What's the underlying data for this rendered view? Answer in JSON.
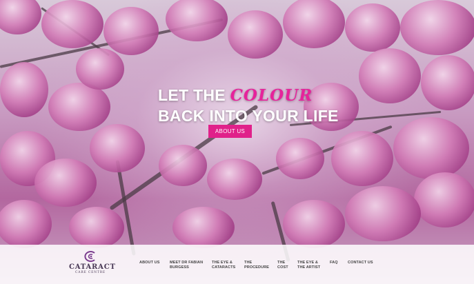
{
  "hero": {
    "title_part1": "LET THE ",
    "title_accent": "COLOUR",
    "title_line2": "BACK INTO YOUR LIFE",
    "cta_label": "ABOUT US"
  },
  "logo": {
    "name": "CATARACT",
    "tagline": "CARE CENTRE"
  },
  "nav": [
    "ABOUT US",
    "MEET DR FABIAN\nBURGESS",
    "THE EYE &\nCATARACTS",
    "THE\nPROCEDURE",
    "THE\nCOST",
    "THE EYE &\nTHE ARTIST",
    "FAQ",
    "CONTACT US"
  ],
  "colors": {
    "accent": "#e0218a",
    "logo": "#4a3a57"
  }
}
